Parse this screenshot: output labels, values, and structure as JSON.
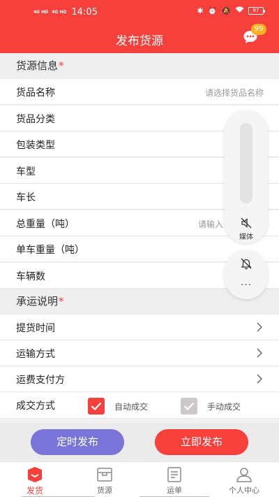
{
  "status_bar": {
    "network_1": "4G HD",
    "network_2": "4G HD",
    "time": "14:05",
    "battery": "87"
  },
  "header": {
    "title": "发布货源",
    "chat_badge": "99"
  },
  "cargo_section": {
    "title": "货源信息",
    "required_mark": "*",
    "fields": [
      {
        "label": "货品名称",
        "placeholder": "请选择货品名称"
      },
      {
        "label": "货品分类"
      },
      {
        "label": "包装类型"
      },
      {
        "label": "车型"
      },
      {
        "label": "车长"
      },
      {
        "label": "总重量（吨）",
        "placeholder": "请输入"
      },
      {
        "label": "单车重量（吨）"
      },
      {
        "label": "车辆数"
      }
    ]
  },
  "shipping_section": {
    "title": "承运说明",
    "required_mark": "*",
    "fields": [
      {
        "label": "提货时间"
      },
      {
        "label": "运输方式"
      },
      {
        "label": "运费支付方"
      }
    ],
    "deal_mode": {
      "label": "成交方式",
      "options": [
        {
          "label": "自动成交",
          "checked": true,
          "color": "#f5403c"
        },
        {
          "label": "手动成交",
          "checked": true,
          "color": "#cfc8c8"
        }
      ]
    }
  },
  "floating_panel": {
    "media_label": "媒体",
    "more": "···"
  },
  "actions": {
    "timed_publish": "定时发布",
    "publish_now": "立即发布"
  },
  "tabbar": {
    "items": [
      {
        "label": "发货",
        "icon": "ship-goods-icon",
        "active": true
      },
      {
        "label": "货源",
        "icon": "cargo-box-icon",
        "active": false
      },
      {
        "label": "运单",
        "icon": "waybill-icon",
        "active": false
      },
      {
        "label": "个人中心",
        "icon": "person-icon",
        "active": false
      }
    ]
  },
  "colors": {
    "brand": "#f5403c",
    "timed_button": "#7a73d8",
    "badge": "#ffb020"
  }
}
